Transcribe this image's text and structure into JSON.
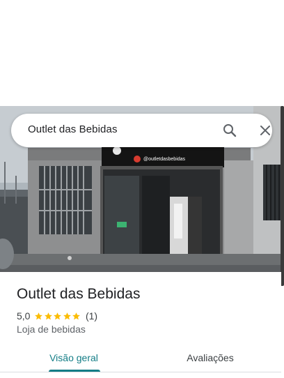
{
  "search": {
    "query": "Outlet das Bebidas"
  },
  "icons": {
    "search": "search-icon",
    "close": "close-icon",
    "star": "star-icon"
  },
  "colors": {
    "accent": "#137d86",
    "star": "#fbbc04",
    "text": "#202124",
    "muted": "#5f6368"
  },
  "photo": {
    "storefront_text": "@outletdasbebidas"
  },
  "place": {
    "name": "Outlet das Bebidas",
    "rating": "5,0",
    "rating_stars": 5,
    "review_count": "(1)",
    "category": "Loja de bebidas"
  },
  "tabs": [
    {
      "label": "Visão geral",
      "active": true
    },
    {
      "label": "Avaliações",
      "active": false
    }
  ]
}
